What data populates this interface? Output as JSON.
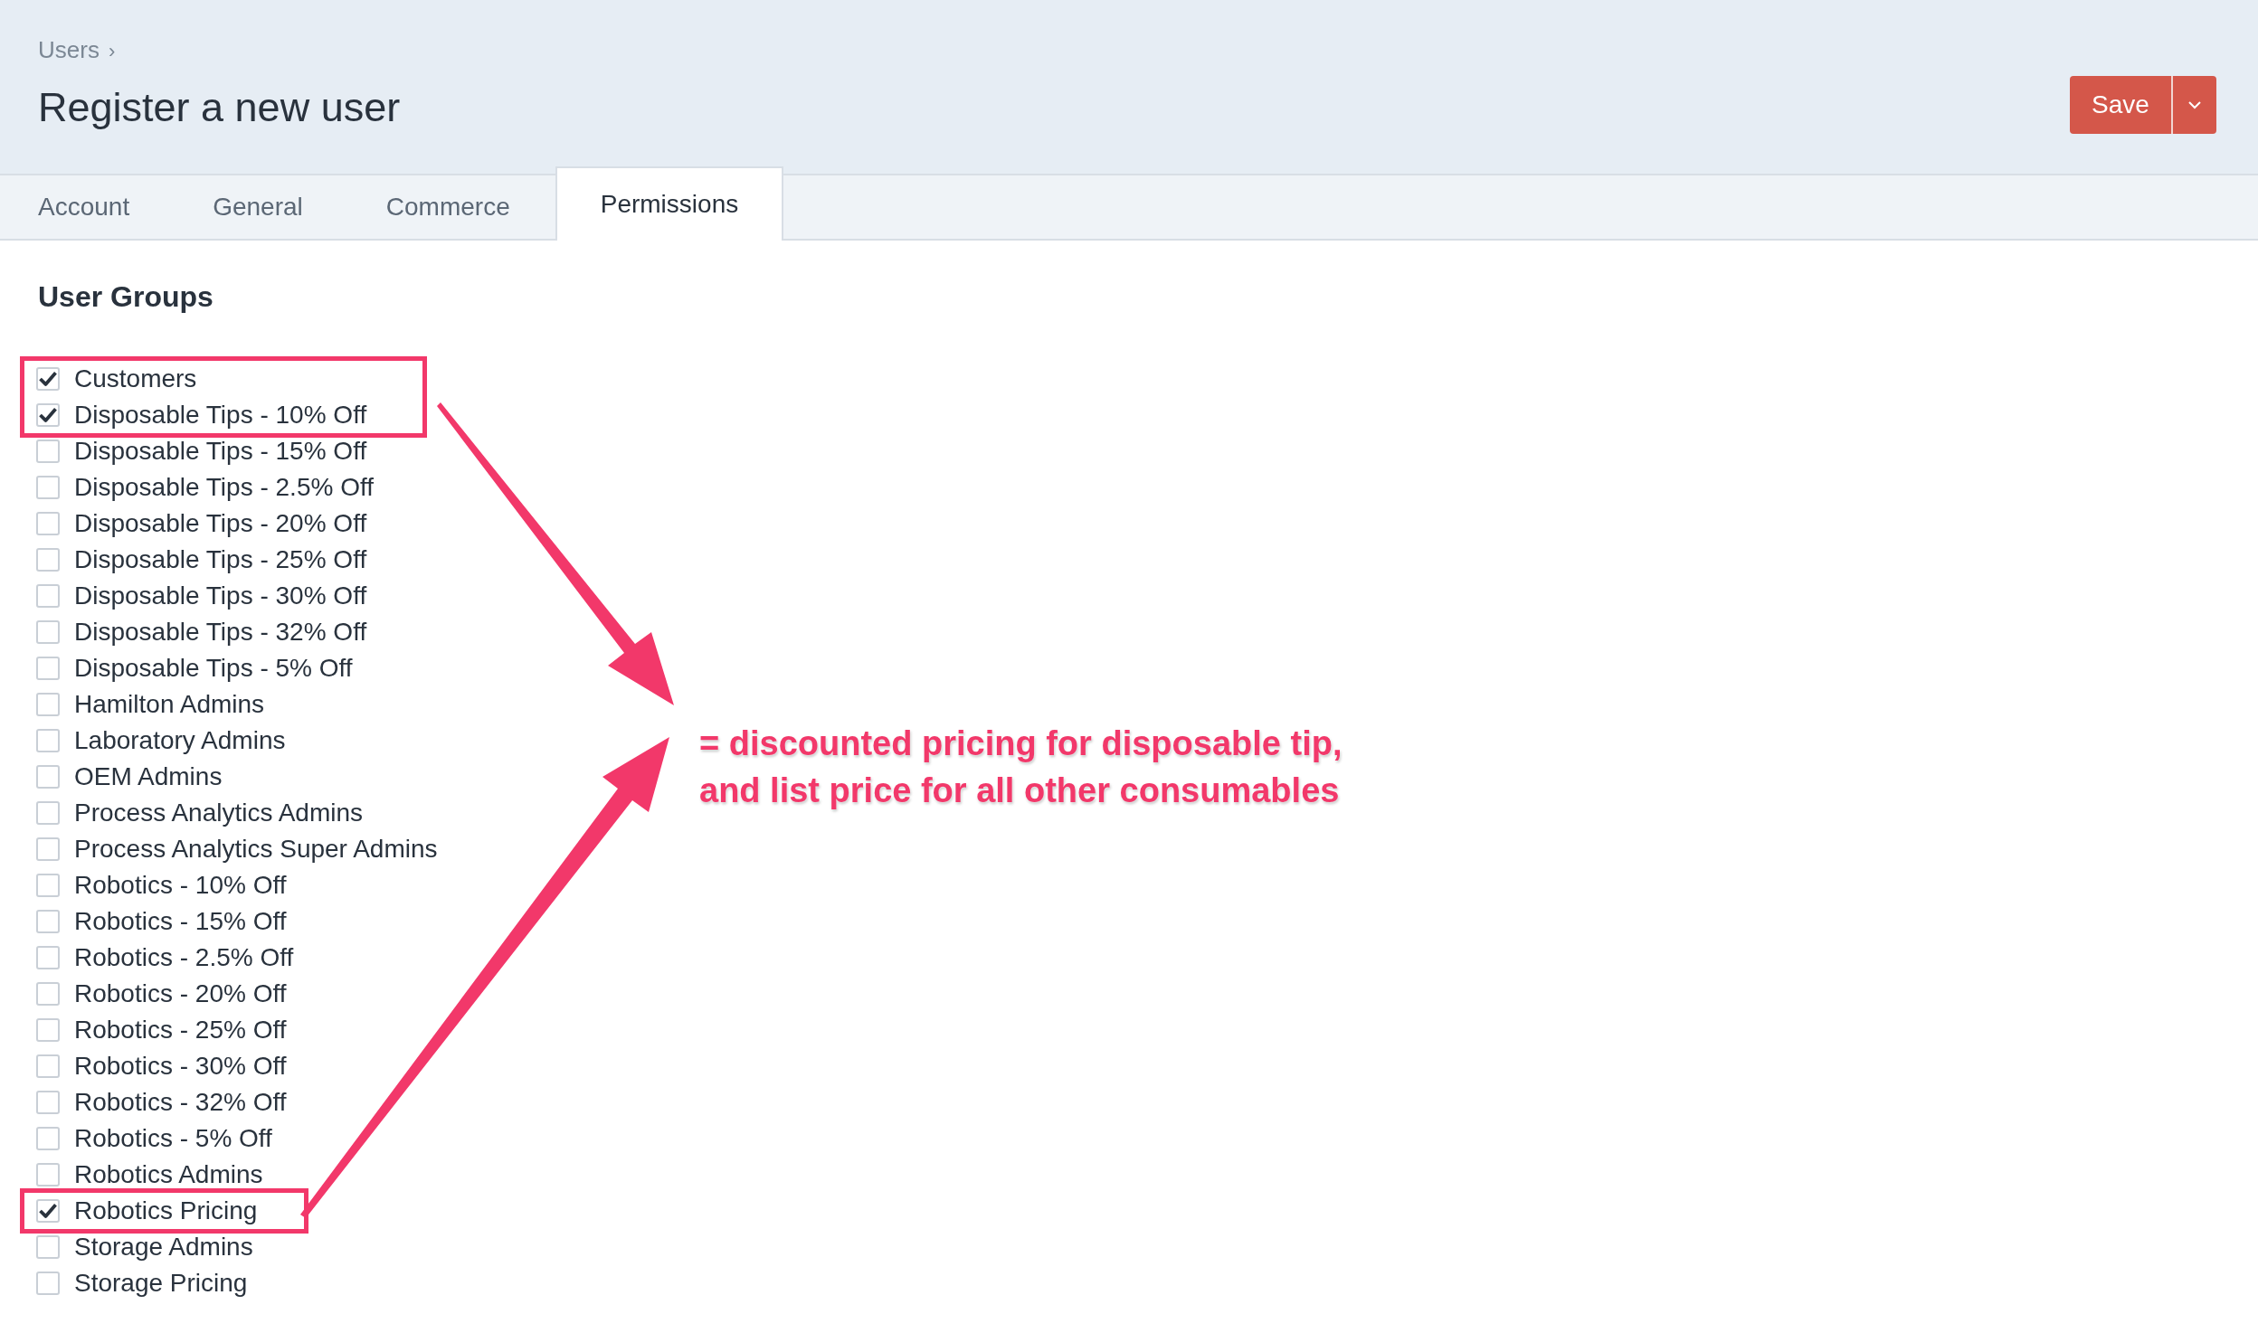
{
  "breadcrumb": {
    "label": "Users",
    "separator": "›"
  },
  "page_title": "Register a new user",
  "save_button": {
    "label": "Save"
  },
  "tabs": [
    {
      "label": "Account",
      "selected": false
    },
    {
      "label": "General",
      "selected": false
    },
    {
      "label": "Commerce",
      "selected": false
    },
    {
      "label": "Permissions",
      "selected": true
    }
  ],
  "section_title": "User Groups",
  "user_groups": [
    {
      "label": "Customers",
      "checked": true,
      "highlighted": true
    },
    {
      "label": "Disposable Tips - 10% Off",
      "checked": true,
      "highlighted": true
    },
    {
      "label": "Disposable Tips - 15% Off",
      "checked": false,
      "highlighted": false
    },
    {
      "label": "Disposable Tips - 2.5% Off",
      "checked": false,
      "highlighted": false
    },
    {
      "label": "Disposable Tips - 20% Off",
      "checked": false,
      "highlighted": false
    },
    {
      "label": "Disposable Tips - 25% Off",
      "checked": false,
      "highlighted": false
    },
    {
      "label": "Disposable Tips - 30% Off",
      "checked": false,
      "highlighted": false
    },
    {
      "label": "Disposable Tips - 32% Off",
      "checked": false,
      "highlighted": false
    },
    {
      "label": "Disposable Tips - 5% Off",
      "checked": false,
      "highlighted": false
    },
    {
      "label": "Hamilton Admins",
      "checked": false,
      "highlighted": false
    },
    {
      "label": "Laboratory Admins",
      "checked": false,
      "highlighted": false
    },
    {
      "label": "OEM Admins",
      "checked": false,
      "highlighted": false
    },
    {
      "label": "Process Analytics Admins",
      "checked": false,
      "highlighted": false
    },
    {
      "label": "Process Analytics Super Admins",
      "checked": false,
      "highlighted": false
    },
    {
      "label": "Robotics - 10% Off",
      "checked": false,
      "highlighted": false
    },
    {
      "label": "Robotics - 15% Off",
      "checked": false,
      "highlighted": false
    },
    {
      "label": "Robotics - 2.5% Off",
      "checked": false,
      "highlighted": false
    },
    {
      "label": "Robotics - 20% Off",
      "checked": false,
      "highlighted": false
    },
    {
      "label": "Robotics - 25% Off",
      "checked": false,
      "highlighted": false
    },
    {
      "label": "Robotics - 30% Off",
      "checked": false,
      "highlighted": false
    },
    {
      "label": "Robotics - 32% Off",
      "checked": false,
      "highlighted": false
    },
    {
      "label": "Robotics - 5% Off",
      "checked": false,
      "highlighted": false
    },
    {
      "label": "Robotics Admins",
      "checked": false,
      "highlighted": false
    },
    {
      "label": "Robotics Pricing",
      "checked": true,
      "highlighted": true
    },
    {
      "label": "Storage Admins",
      "checked": false,
      "highlighted": false
    },
    {
      "label": "Storage Pricing",
      "checked": false,
      "highlighted": false
    }
  ],
  "annotation": {
    "lines": [
      "= discounted pricing for disposable tip,",
      "and list price for all other consumables"
    ]
  }
}
